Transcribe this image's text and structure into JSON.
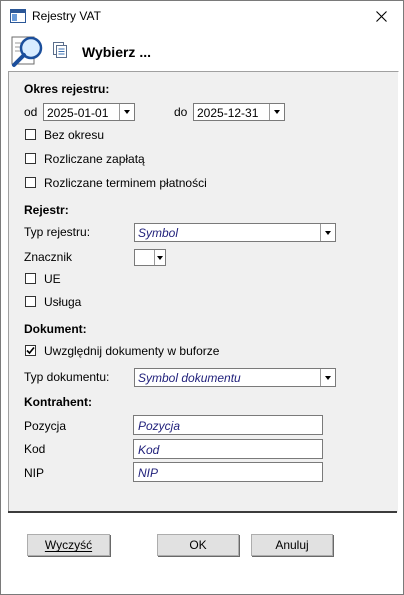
{
  "window": {
    "title": "Rejestry VAT"
  },
  "header": {
    "title": "Wybierz ..."
  },
  "okres": {
    "section": "Okres rejestru:",
    "od_label": "od",
    "od_value": "2025-01-01",
    "do_label": "do",
    "do_value": "2025-12-31",
    "bez_okresu": "Bez okresu",
    "rozliczane_zaplata": "Rozliczane zapłatą",
    "rozliczane_terminem": "Rozliczane terminem płatności"
  },
  "rejestr": {
    "section": "Rejestr:",
    "typ_label": "Typ rejestru:",
    "typ_value": "Symbol",
    "znacznik_label": "Znacznik",
    "ue": "UE",
    "usluga": "Usługa"
  },
  "dokument": {
    "section": "Dokument:",
    "uwzglednij": "Uwzględnij dokumenty w buforze",
    "uwzglednij_checked": true,
    "typ_label": "Typ dokumentu:",
    "typ_value": "Symbol dokumentu"
  },
  "kontrahent": {
    "section": "Kontrahent:",
    "pozycja_label": "Pozycja",
    "pozycja_value": "Pozycja",
    "kod_label": "Kod",
    "kod_value": "Kod",
    "nip_label": "NIP",
    "nip_value": "NIP"
  },
  "buttons": {
    "wyczysc_pre": "Wyczyść",
    "ok": "OK",
    "anuluj": "Anuluj"
  }
}
